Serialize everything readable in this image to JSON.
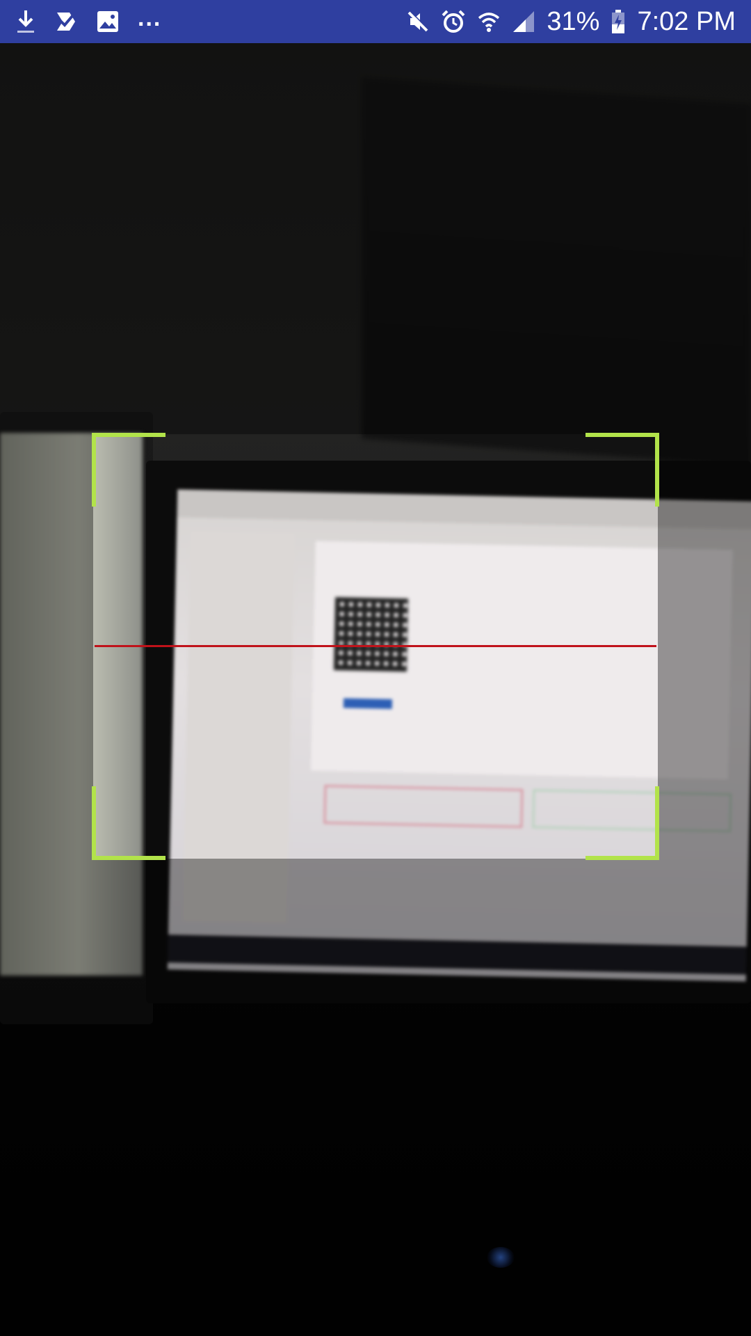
{
  "status_bar": {
    "notifications": [
      "download-icon",
      "task-done-icon",
      "image-icon"
    ],
    "more_label": "...",
    "battery_percent": "31%",
    "time": "7:02 PM",
    "background_color": "#2f3fa0"
  },
  "scanner": {
    "corner_color": "#b2e34a",
    "laser_color": "#c0121a"
  }
}
